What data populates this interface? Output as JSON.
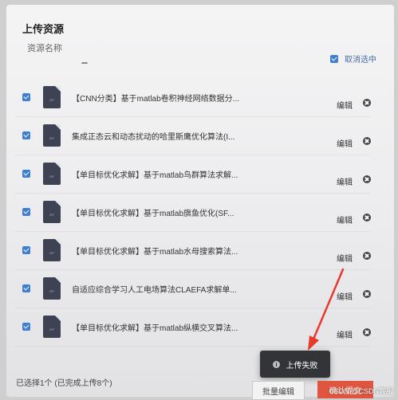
{
  "dialog": {
    "title": "上传资源",
    "column_header": "资源名称",
    "cancel_all_label": "取消选中"
  },
  "files": [
    {
      "name": "【CNN分类】基于matlab卷积神经网络数据分...",
      "edit": "编辑",
      "icon_label": "ZIP"
    },
    {
      "name": "集成正态云和动态扰动的哈里斯鹰优化算法(I...",
      "edit": "编辑",
      "icon_label": "ZIP"
    },
    {
      "name": "【单目标优化求解】基于matlab鸟群算法求解...",
      "edit": "编辑",
      "icon_label": "ZIP"
    },
    {
      "name": "【单目标优化求解】基于matlab旗鱼优化(SF...",
      "edit": "编辑",
      "icon_label": "ZIP"
    },
    {
      "name": "【单目标优化求解】基于matlab水母搜索算法...",
      "edit": "编辑",
      "icon_label": "ZIP"
    },
    {
      "name": "自适应综合学习人工电场算法CLAEFA求解单...",
      "edit": "编辑",
      "icon_label": "ZIP"
    },
    {
      "name": "【单目标优化求解】基于matlab纵横交叉算法...",
      "edit": "编辑",
      "icon_label": "ZIP"
    }
  ],
  "toast": {
    "message": "上传失败"
  },
  "footer": {
    "status": "已选择1个 (已完成上传8个)",
    "batch_edit": "批量编辑",
    "confirm": "确认提交"
  },
  "watermark": "CSDN @CSDN客服",
  "colors": {
    "accent_red": "#e0553f",
    "checkbox_blue": "#3f7fd1",
    "arrow_red": "#e8392a"
  }
}
